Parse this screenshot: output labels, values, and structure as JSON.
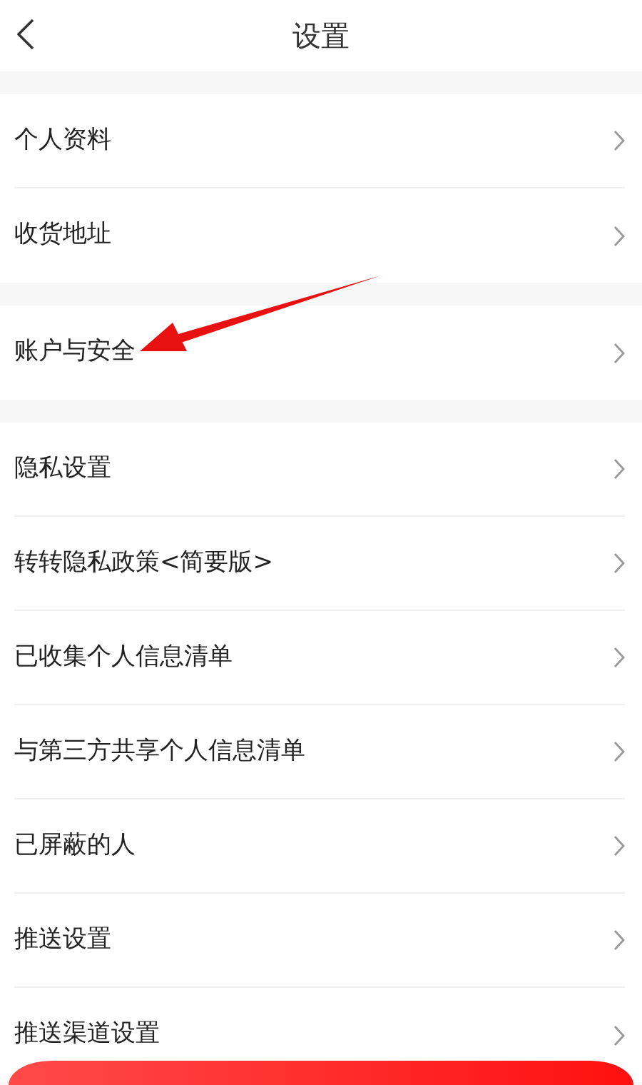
{
  "header": {
    "title": "设置"
  },
  "groups": [
    {
      "items": [
        {
          "label": "个人资料"
        },
        {
          "label": "收货地址"
        }
      ]
    },
    {
      "items": [
        {
          "label": "账户与安全"
        }
      ]
    },
    {
      "items": [
        {
          "label": "隐私设置"
        },
        {
          "label": "转转隐私政策<简要版>"
        },
        {
          "label": "已收集个人信息清单"
        },
        {
          "label": "与第三方共享个人信息清单"
        },
        {
          "label": "已屏蔽的人"
        },
        {
          "label": "推送设置"
        },
        {
          "label": "推送渠道设置"
        }
      ]
    }
  ],
  "bottom_button": {
    "kind": "button"
  }
}
